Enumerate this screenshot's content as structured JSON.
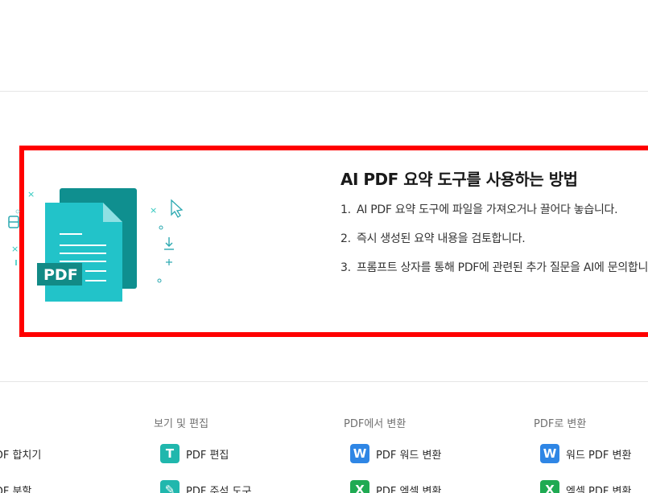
{
  "howto": {
    "title": "AI PDF 요약 도구를 사용하는 방법",
    "steps": [
      {
        "num": "1.",
        "text": "AI PDF 요약 도구에 파일을 가져오거나 끌어다 놓습니다."
      },
      {
        "num": "2.",
        "text": "즉시 생성된 요약 내용을 검토합니다."
      },
      {
        "num": "3.",
        "text": "프롬프트 상자를 통해 PDF에 관련된 추가 질문을 AI에 문의합니다."
      }
    ],
    "illustration": {
      "badge": "PDF",
      "icon": "pdf-document-icon",
      "colors": {
        "front": "#22c3c9",
        "back": "#0f8f8f",
        "badge": "#128a86",
        "accent": "#2cc7bd"
      }
    }
  },
  "footer": {
    "col1": {
      "items": [
        "PDF 합치기",
        "PDF 분할"
      ]
    },
    "col2": {
      "heading": "보기 및 편집",
      "items": [
        {
          "label": "PDF 편집",
          "icon": "pdf-edit-icon",
          "glyph": "T"
        },
        {
          "label": "PDF 주석 도구",
          "icon": "pdf-annotate-icon",
          "glyph": "✎"
        }
      ]
    },
    "col3": {
      "heading": "PDF에서 변환",
      "items": [
        {
          "label": "PDF 워드 변환",
          "icon": "word-icon",
          "glyph": "W"
        },
        {
          "label": "PDF 엑셀 변환",
          "icon": "excel-icon",
          "glyph": "X"
        }
      ]
    },
    "col4": {
      "heading": "PDF로 변환",
      "items": [
        {
          "label": "워드 PDF 변환",
          "icon": "word-icon",
          "glyph": "W"
        },
        {
          "label": "엑셀 PDF 변환",
          "icon": "excel-icon",
          "glyph": "X"
        }
      ]
    }
  },
  "colors": {
    "highlight": "#ff0000",
    "teal": "#20b7ad",
    "word": "#2f86e5",
    "excel": "#1faa52"
  }
}
